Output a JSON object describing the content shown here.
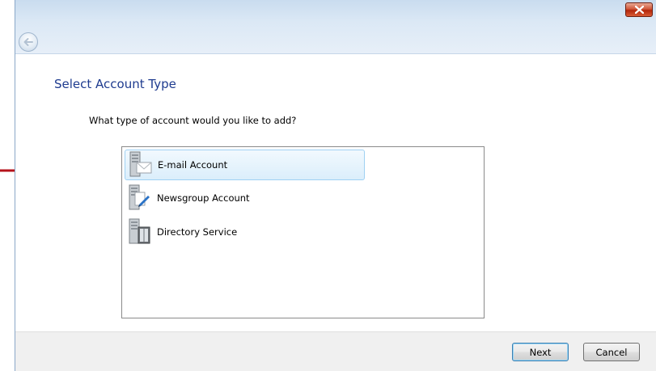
{
  "window": {
    "close_label": "Close",
    "back_label": "Back"
  },
  "page": {
    "heading": "Select Account Type",
    "question": "What type of account would you like to add?"
  },
  "account_types": [
    {
      "label": "E-mail Account",
      "icon": "email-account-icon",
      "selected": true
    },
    {
      "label": "Newsgroup Account",
      "icon": "newsgroup-account-icon",
      "selected": false
    },
    {
      "label": "Directory Service",
      "icon": "directory-service-icon",
      "selected": false
    }
  ],
  "footer": {
    "next_label": "Next",
    "cancel_label": "Cancel"
  },
  "colors": {
    "heading": "#1e3b8f",
    "selection": "#dbeefb",
    "arrow": "#b5121b",
    "close": "#c8401e"
  }
}
